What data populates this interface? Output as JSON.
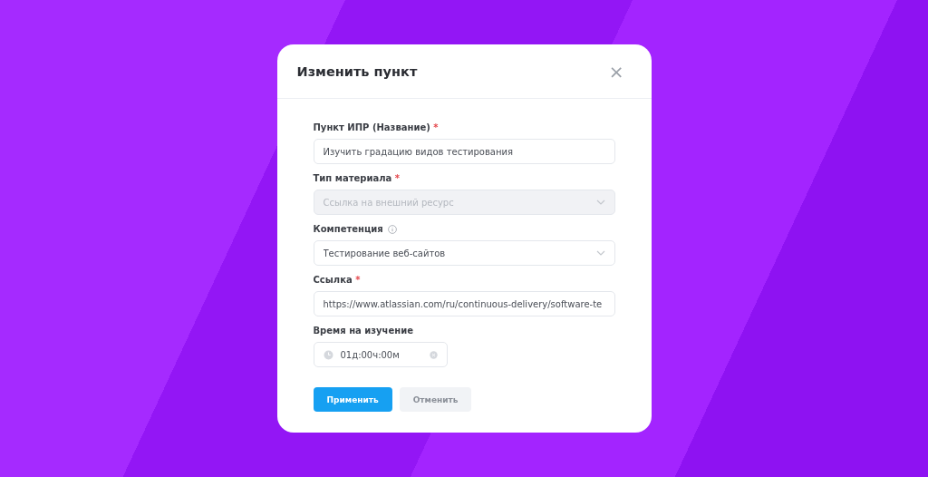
{
  "dialog": {
    "title": "Изменить пункт",
    "close": "×"
  },
  "fields": [
    {
      "kind": "text",
      "label": "Пункт ИПР (Название)",
      "required": true,
      "info": false,
      "disabled": false,
      "value": "Изучить градацию видов тестирования"
    },
    {
      "kind": "select",
      "label": "Тип материала",
      "required": true,
      "info": false,
      "disabled": true,
      "value": "Ссылка на внешний ресурс"
    },
    {
      "kind": "select",
      "label": "Компетенция",
      "required": false,
      "info": true,
      "disabled": false,
      "value": "Тестирование веб-сайтов"
    },
    {
      "kind": "text",
      "label": "Ссылка",
      "required": true,
      "info": false,
      "disabled": false,
      "value": "https://www.atlassian.com/ru/continuous-delivery/software-te"
    },
    {
      "kind": "time",
      "label": "Время на изучение",
      "required": false,
      "info": false,
      "disabled": false,
      "value": "01д:00ч:00м"
    }
  ],
  "required_mark": "*",
  "buttons": [
    {
      "label": "Применить",
      "primary": true
    },
    {
      "label": "Отменить",
      "primary": false
    }
  ]
}
